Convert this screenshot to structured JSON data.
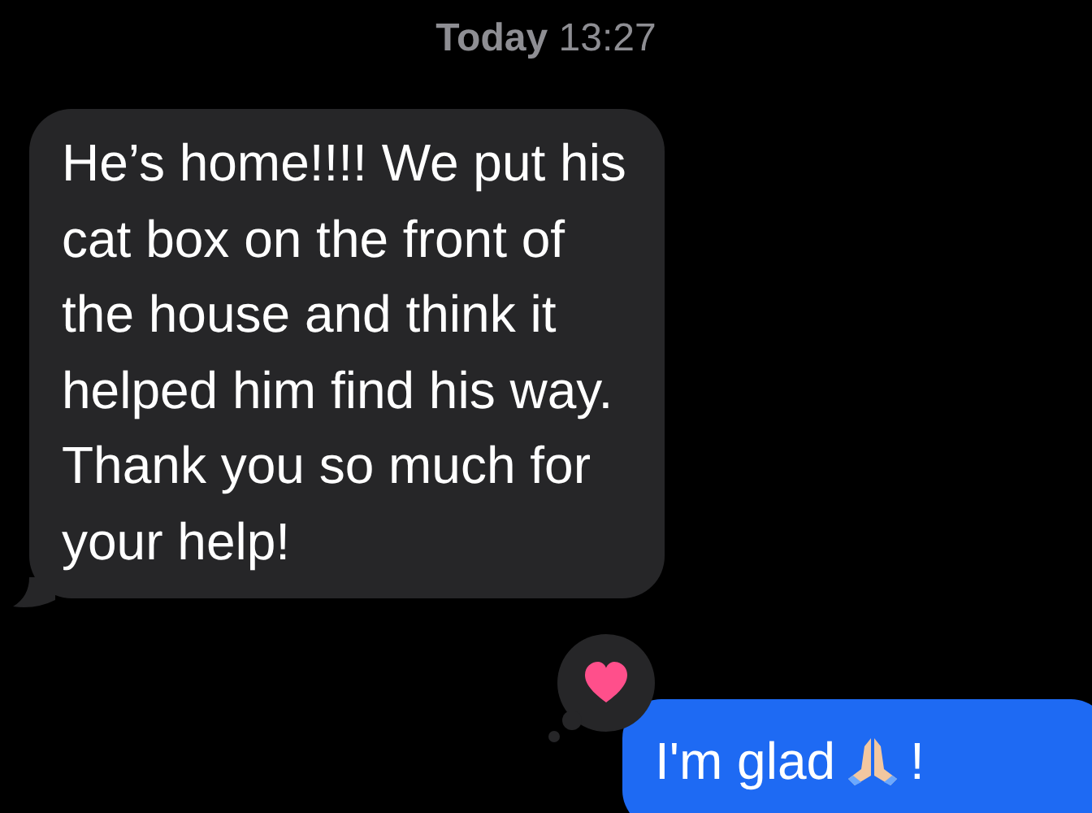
{
  "timestamp": "**Today** 13:27",
  "messages": [
    {
      "kind": "received",
      "lines": [
        "He’s home!!!! We put his",
        "cat box on the front of",
        "the house and think it",
        "helped him find his way.",
        "Thank you so much for",
        "your help!"
      ]
    },
    {
      "kind": "sent",
      "lines": [
        "I'm glad",
        "!"
      ],
      "reacted": true
    }
  ]
}
